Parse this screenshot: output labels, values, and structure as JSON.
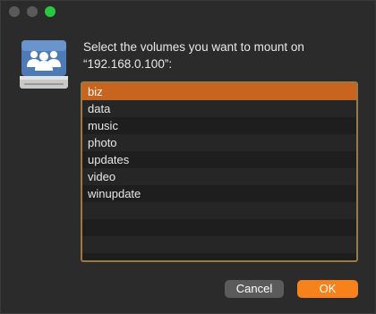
{
  "dialog": {
    "prompt": "Select the volumes you want to mount on “192.168.0.100”:",
    "icon": "network-drive-icon"
  },
  "volumes": [
    {
      "label": "biz",
      "selected": true
    },
    {
      "label": "data",
      "selected": false
    },
    {
      "label": "music",
      "selected": false
    },
    {
      "label": "photo",
      "selected": false
    },
    {
      "label": "updates",
      "selected": false
    },
    {
      "label": "video",
      "selected": false
    },
    {
      "label": "winupdate",
      "selected": false
    }
  ],
  "buttons": {
    "cancel_label": "Cancel",
    "ok_label": "OK"
  },
  "colors": {
    "accent": "#f7821b",
    "selection": "#c8641e",
    "focus_ring": "#9a7a40"
  }
}
